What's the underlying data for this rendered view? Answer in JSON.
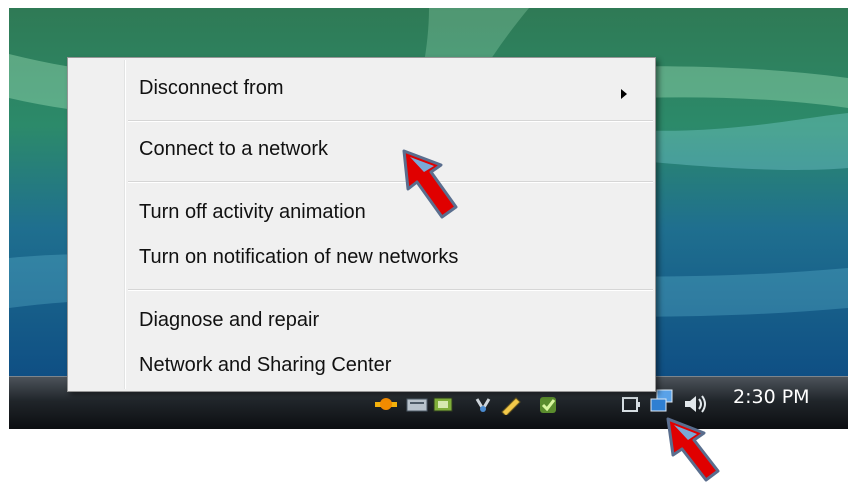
{
  "context_menu": {
    "items": [
      {
        "label": "Disconnect from",
        "has_submenu": true
      },
      {
        "label": "Connect to a network"
      },
      {
        "label": "Turn off activity animation"
      },
      {
        "label": "Turn on notification of new networks"
      },
      {
        "label": "Diagnose and repair"
      },
      {
        "label": "Network and Sharing Center"
      }
    ]
  },
  "taskbar": {
    "clock": "2:30 PM",
    "tray_icons": [
      "security-shield-icon",
      "hardware-icon",
      "display-icon",
      "usb-icon",
      "pen-icon",
      "check-icon",
      "power-icon",
      "network-icon",
      "speaker-icon"
    ]
  },
  "colors": {
    "accent_arrow": "#e00000",
    "menu_background": "#f0f0f0"
  }
}
